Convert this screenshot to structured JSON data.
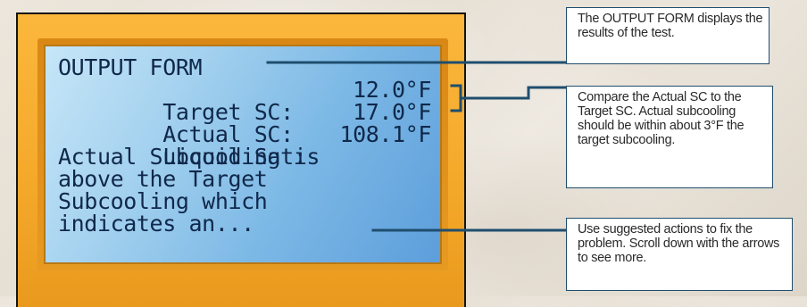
{
  "screen": {
    "title": "OUTPUT FORM",
    "rows": [
      {
        "label": "Target SC:",
        "value": "12.0°F"
      },
      {
        "label": "Actual SC:",
        "value": "17.0°F"
      },
      {
        "label": "Liquid Sat:",
        "value": "108.1°F"
      }
    ],
    "message_lines": [
      "Actual Subcooling is",
      "above the Target",
      "Subcooling which",
      "indicates an..."
    ]
  },
  "callouts": [
    {
      "text": "The OUTPUT FORM displays the results of the test."
    },
    {
      "text": "Compare the Actual SC to the Target SC.  Actual subcooling should be within about 3°F the target subcooling."
    },
    {
      "text": "Use suggested actions to fix the problem.  Scroll down with the arrows to see more."
    }
  ],
  "colors": {
    "device_body": "#f4a82a",
    "lcd_text": "#10284a",
    "lcd_background": "#7db9e6",
    "callout_border": "#1f4e6e",
    "leader_line": "#1f4e6e"
  }
}
